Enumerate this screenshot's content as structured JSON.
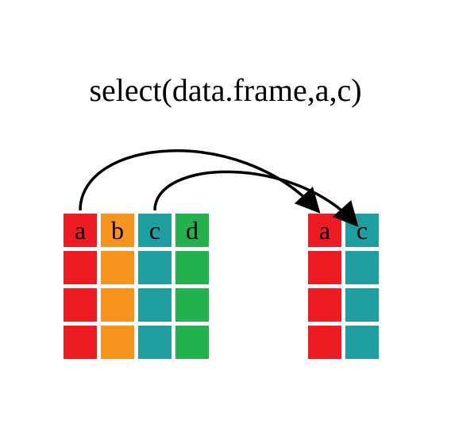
{
  "title": "select(data.frame,a,c)",
  "colors": {
    "a": "#ed1c24",
    "b": "#f7941d",
    "c": "#1e9e9e",
    "d": "#22b14c"
  },
  "source_table": {
    "columns": [
      "a",
      "b",
      "c",
      "d"
    ],
    "rows": 4
  },
  "result_table": {
    "columns": [
      "a",
      "c"
    ],
    "rows": 4
  },
  "mapping": [
    {
      "from": "a",
      "to": "a"
    },
    {
      "from": "c",
      "to": "c"
    }
  ],
  "chart_data": {
    "type": "table",
    "title": "select(data.frame,a,c)",
    "description": "dplyr select() keeps columns a and c from a 4-column, 4-row data frame",
    "input_columns": [
      "a",
      "b",
      "c",
      "d"
    ],
    "output_columns": [
      "a",
      "c"
    ],
    "n_rows": 4,
    "column_colors": {
      "a": "#ed1c24",
      "b": "#f7941d",
      "c": "#1e9e9e",
      "d": "#22b14c"
    }
  }
}
